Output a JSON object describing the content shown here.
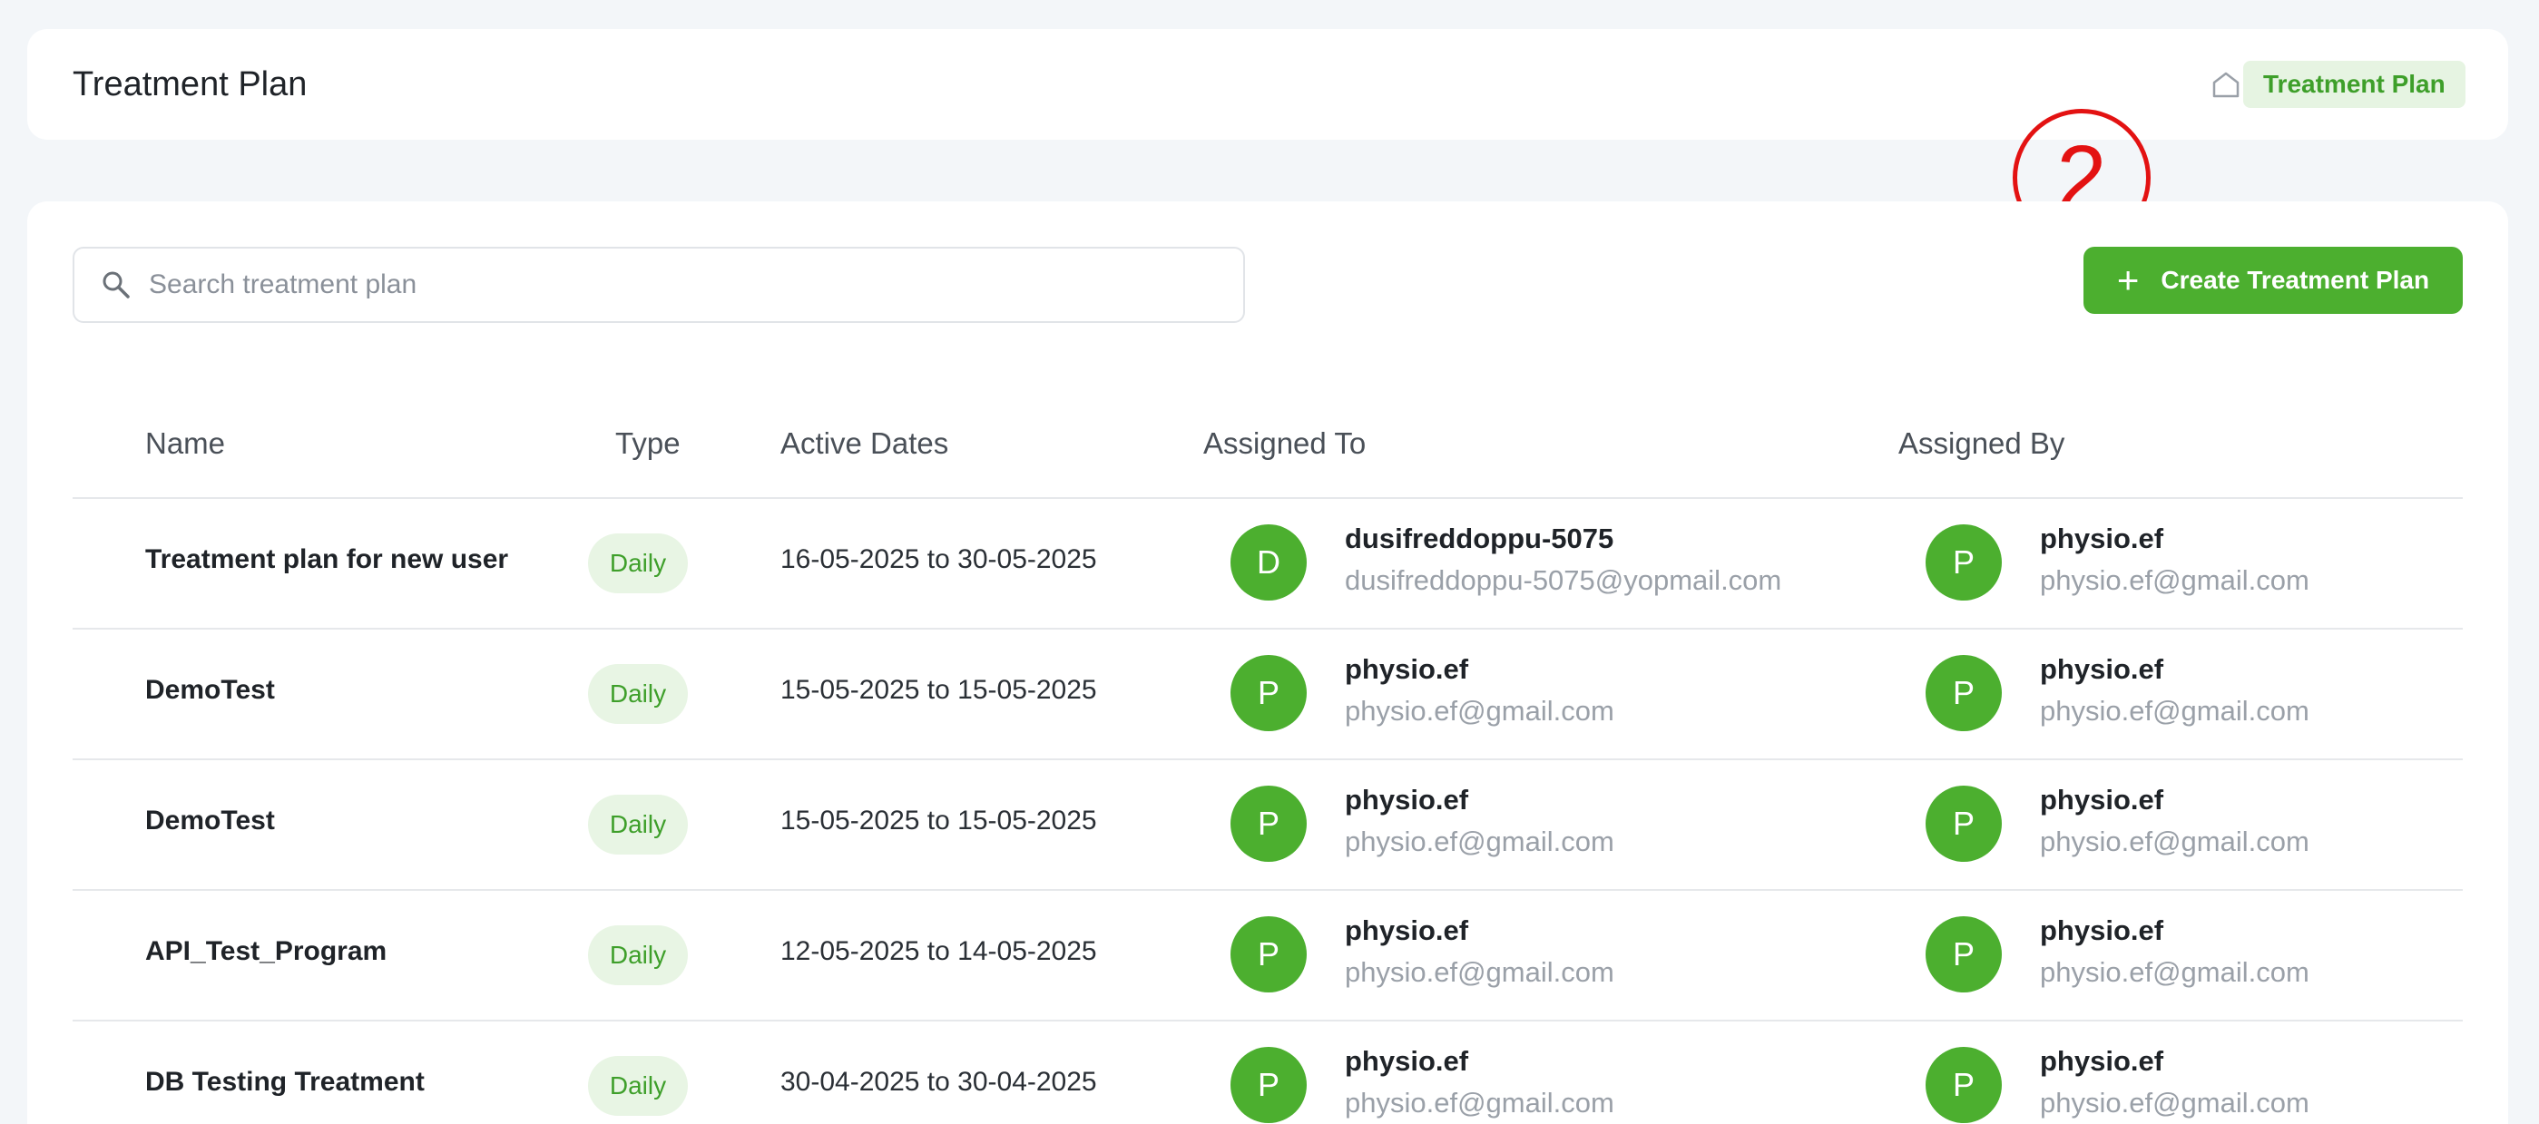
{
  "header": {
    "title": "Treatment Plan",
    "breadcrumb_home_icon": "home-icon",
    "breadcrumb_current": "Treatment Plan"
  },
  "annotation": {
    "label": "2",
    "color": "#e31212"
  },
  "toolbar": {
    "search_placeholder": "Search treatment plan",
    "search_value": "",
    "create_label": "Create Treatment Plan",
    "create_icon": "plus-icon"
  },
  "table": {
    "columns": [
      "Name",
      "Type",
      "Active Dates",
      "Assigned To",
      "Assigned By"
    ],
    "rows": [
      {
        "name": "Treatment plan for new user",
        "type": "Daily",
        "dates": "16-05-2025 to 30-05-2025",
        "assigned_to": {
          "initial": "D",
          "name": "dusifreddoppu-5075",
          "email": "dusifreddoppu-5075@yopmail.com"
        },
        "assigned_by": {
          "initial": "P",
          "name": "physio.ef",
          "email": "physio.ef@gmail.com"
        }
      },
      {
        "name": "DemoTest",
        "type": "Daily",
        "dates": "15-05-2025 to 15-05-2025",
        "assigned_to": {
          "initial": "P",
          "name": "physio.ef",
          "email": "physio.ef@gmail.com"
        },
        "assigned_by": {
          "initial": "P",
          "name": "physio.ef",
          "email": "physio.ef@gmail.com"
        }
      },
      {
        "name": "DemoTest",
        "type": "Daily",
        "dates": "15-05-2025 to 15-05-2025",
        "assigned_to": {
          "initial": "P",
          "name": "physio.ef",
          "email": "physio.ef@gmail.com"
        },
        "assigned_by": {
          "initial": "P",
          "name": "physio.ef",
          "email": "physio.ef@gmail.com"
        }
      },
      {
        "name": "API_Test_Program",
        "type": "Daily",
        "dates": "12-05-2025 to 14-05-2025",
        "assigned_to": {
          "initial": "P",
          "name": "physio.ef",
          "email": "physio.ef@gmail.com"
        },
        "assigned_by": {
          "initial": "P",
          "name": "physio.ef",
          "email": "physio.ef@gmail.com"
        }
      },
      {
        "name": "DB Testing Treatment",
        "type": "Daily",
        "dates": "30-04-2025 to 30-04-2025",
        "assigned_to": {
          "initial": "P",
          "name": "physio.ef",
          "email": "physio.ef@gmail.com"
        },
        "assigned_by": {
          "initial": "P",
          "name": "physio.ef",
          "email": "physio.ef@gmail.com"
        }
      }
    ]
  },
  "colors": {
    "accent": "#4caf2f",
    "accent_light": "#e8f5e4",
    "annotation": "#e31212"
  }
}
